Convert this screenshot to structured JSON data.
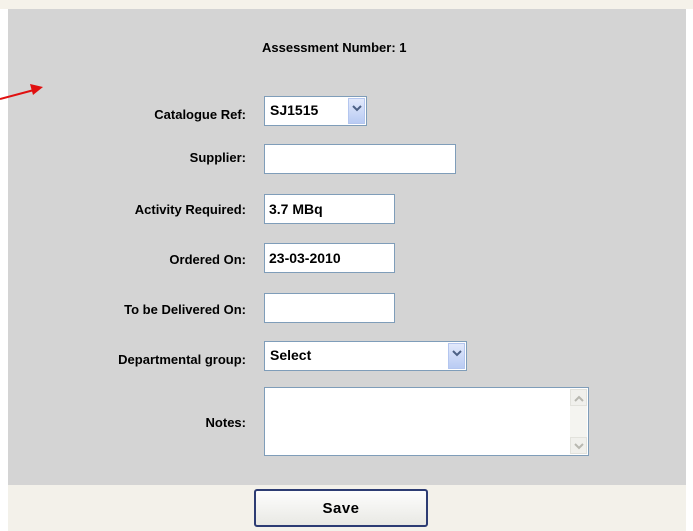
{
  "header": {
    "assessment_number": "Assessment Number: 1"
  },
  "form": {
    "catalogue_ref": {
      "label": "Catalogue Ref:",
      "selected": "SJ1515"
    },
    "supplier": {
      "label": "Supplier:",
      "value": ""
    },
    "activity_required": {
      "label": "Activity Required:",
      "value": "3.7 MBq"
    },
    "ordered_on": {
      "label": "Ordered On:",
      "value": "23-03-2010"
    },
    "to_be_delivered_on": {
      "label": "To be Delivered On:",
      "value": ""
    },
    "departmental_group": {
      "label": "Departmental group:",
      "selected": "Select"
    },
    "notes": {
      "label": "Notes:",
      "value": ""
    }
  },
  "actions": {
    "save_label": "Save"
  },
  "colors": {
    "panel": "#d4d4d4",
    "arrow": "#e01010",
    "button_border": "#2d3c73",
    "field_border": "#7f9db9"
  },
  "icons": [
    "red-arrow-icon",
    "chevron-down-icon",
    "scroll-up-icon",
    "scroll-down-icon"
  ]
}
